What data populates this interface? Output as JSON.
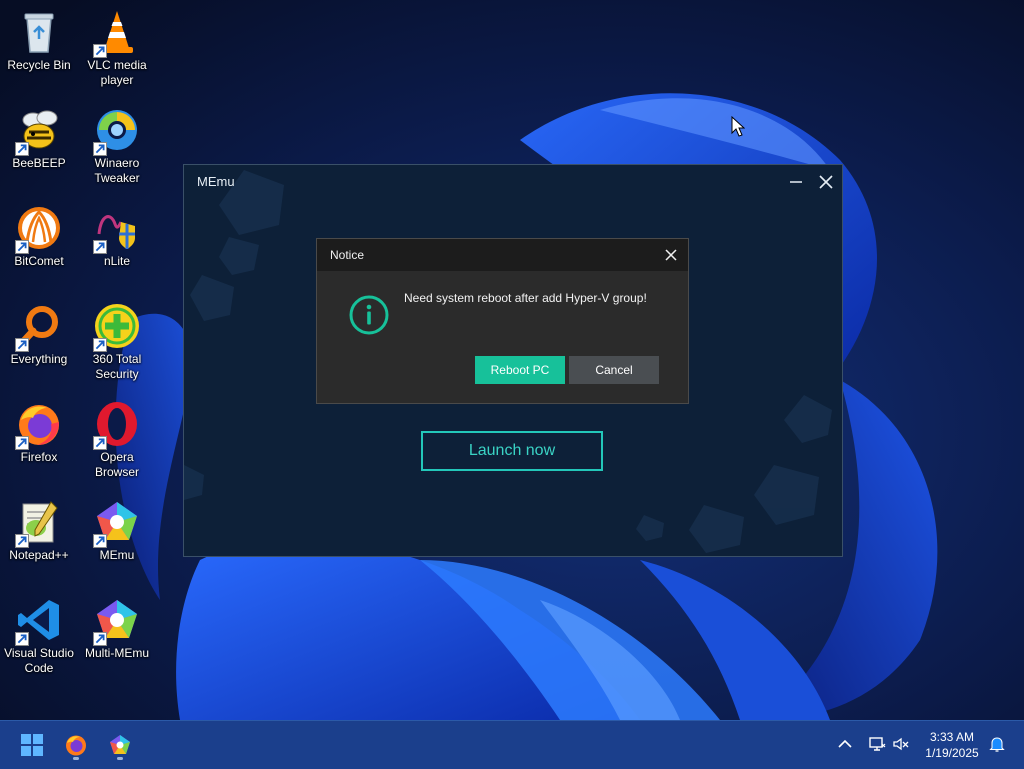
{
  "desktop": {
    "icons": [
      {
        "label": "Recycle Bin",
        "icon": "recycle-bin-icon"
      },
      {
        "label": "VLC media\nplayer",
        "icon": "vlc-icon"
      },
      {
        "label": "BeeBEEP",
        "icon": "beebeep-icon"
      },
      {
        "label": "Winaero\nTweaker",
        "icon": "winaero-tweaker-icon"
      },
      {
        "label": "BitComet",
        "icon": "bitcomet-icon"
      },
      {
        "label": "nLite",
        "icon": "nlite-icon"
      },
      {
        "label": "Everything",
        "icon": "everything-icon"
      },
      {
        "label": "360 Total\nSecurity",
        "icon": "360-total-security-icon"
      },
      {
        "label": "Firefox",
        "icon": "firefox-icon"
      },
      {
        "label": "Opera\nBrowser",
        "icon": "opera-icon"
      },
      {
        "label": "Notepad++",
        "icon": "notepadpp-icon"
      },
      {
        "label": "MEmu",
        "icon": "memu-icon"
      },
      {
        "label": "Visual Studio\nCode",
        "icon": "vscode-icon"
      },
      {
        "label": "Multi-MEmu",
        "icon": "multi-memu-icon"
      }
    ]
  },
  "memu_window": {
    "title": "MEmu",
    "launch_label": "Launch now"
  },
  "notice": {
    "title": "Notice",
    "message": "Need system reboot after add Hyper-V group!",
    "reboot_label": "Reboot PC",
    "cancel_label": "Cancel",
    "accent": "#17c19a"
  },
  "taskbar": {
    "pinned": [
      "start-icon",
      "firefox-icon",
      "memu-icon"
    ],
    "tray": [
      "chevron-up-icon",
      "network-icon",
      "volume-muted-icon",
      "notification-icon"
    ],
    "time": "3:33 AM",
    "date": "1/19/2025"
  }
}
